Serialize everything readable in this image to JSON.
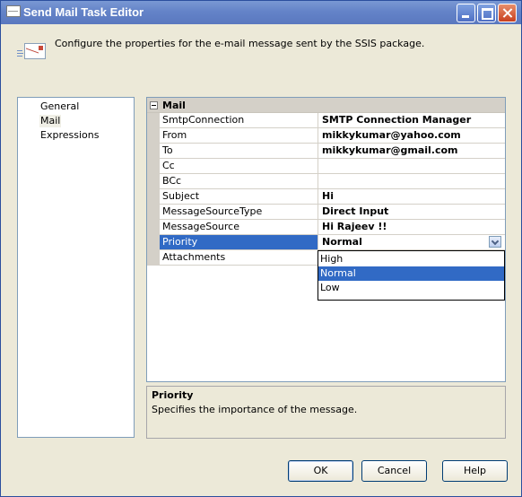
{
  "window": {
    "title": "Send Mail Task Editor",
    "icon": "window-icon",
    "controls": [
      "minimize-icon",
      "maximize-icon",
      "close-icon"
    ]
  },
  "header": {
    "icon": "mail-envelope-icon",
    "text": "Configure the properties for the e-mail message sent by the SSIS package."
  },
  "nav": {
    "items": [
      {
        "label": "General",
        "selected": false
      },
      {
        "label": "Mail",
        "selected": true
      },
      {
        "label": "Expressions",
        "selected": false
      }
    ]
  },
  "grid": {
    "category": "Mail",
    "properties": [
      {
        "name": "SmtpConnection",
        "value": "SMTP Connection Manager"
      },
      {
        "name": "From",
        "value": "mikkykumar@yahoo.com"
      },
      {
        "name": "To",
        "value": "mikkykumar@gmail.com"
      },
      {
        "name": "Cc",
        "value": ""
      },
      {
        "name": "BCc",
        "value": ""
      },
      {
        "name": "Subject",
        "value": "Hi"
      },
      {
        "name": "MessageSourceType",
        "value": "Direct Input"
      },
      {
        "name": "MessageSource",
        "value": "Hi Rajeev !!"
      },
      {
        "name": "Priority",
        "value": "Normal",
        "selected": true
      },
      {
        "name": "Attachments",
        "value": ""
      }
    ],
    "priority_options": [
      "High",
      "Normal",
      "Low"
    ],
    "priority_selected": "Normal"
  },
  "description": {
    "title": "Priority",
    "text": "Specifies the importance of the message."
  },
  "buttons": {
    "ok": "OK",
    "cancel": "Cancel",
    "help": "Help"
  },
  "colors": {
    "selection": "#316ac5",
    "titlebar": "#6483c8"
  }
}
